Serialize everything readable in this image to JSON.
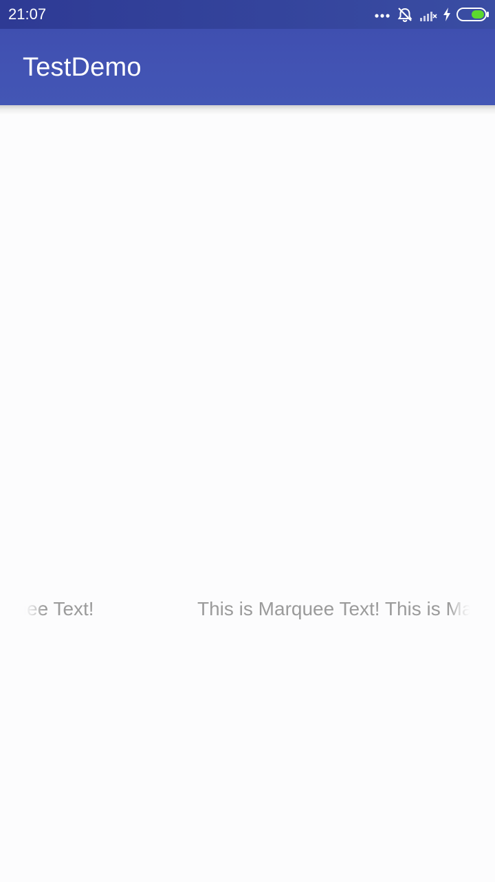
{
  "status_bar": {
    "time": "21:07",
    "icons": [
      "more-dots-icon",
      "alarm-off-icon",
      "signal-icon",
      "charging-bolt-icon",
      "battery-icon"
    ],
    "colors": {
      "background": "#303f9f",
      "icon": "#ffffff",
      "battery_fill": "#5cd92e"
    }
  },
  "app_bar": {
    "title": "TestDemo",
    "colors": {
      "background": "#3f51b5",
      "title": "#ffffff"
    }
  },
  "marquee": {
    "text": "This is Marquee Text!",
    "frame_text_1": "This is Marquee Text!",
    "frame_text_2": "This is Marquee Text! This is Marquee Text!",
    "color": "#9b9b9b"
  }
}
